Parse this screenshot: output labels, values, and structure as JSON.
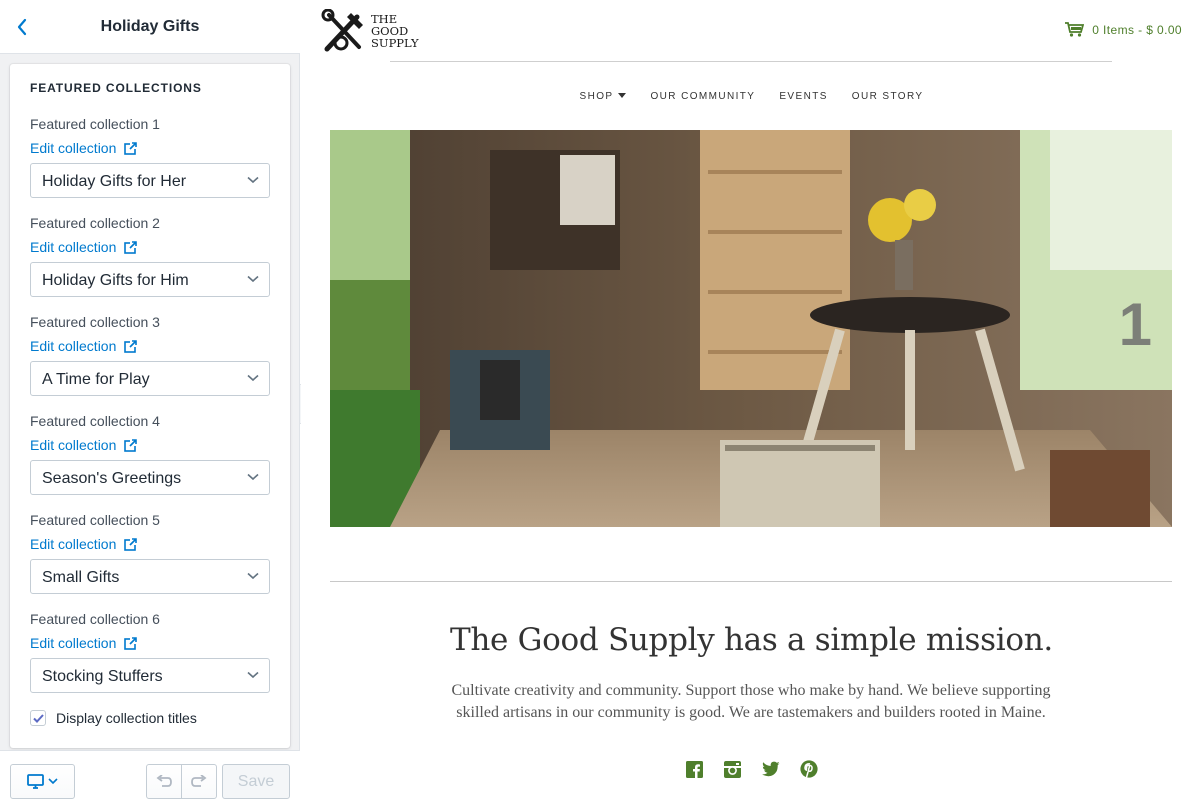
{
  "editor": {
    "title": "Holiday Gifts",
    "section_heading": "FEATURED COLLECTIONS",
    "edit_link_label": "Edit collection",
    "collections": [
      {
        "label": "Featured collection 1",
        "value": "Holiday Gifts for Her"
      },
      {
        "label": "Featured collection 2",
        "value": "Holiday Gifts for Him"
      },
      {
        "label": "Featured collection 3",
        "value": "A Time for Play"
      },
      {
        "label": "Featured collection 4",
        "value": "Season's Greetings"
      },
      {
        "label": "Featured collection 5",
        "value": "Small Gifts"
      },
      {
        "label": "Featured collection 6",
        "value": "Stocking Stuffers"
      }
    ],
    "display_titles": {
      "label": "Display collection titles",
      "checked": true
    },
    "footer": {
      "save_label": "Save"
    }
  },
  "storefront": {
    "logo_lines": [
      "THE",
      "GOOD",
      "SUPPLY"
    ],
    "cart": "0 Items - $ 0.00",
    "nav": [
      "SHOP",
      "OUR COMMUNITY",
      "EVENTS",
      "OUR STORY"
    ],
    "slide_number": "1",
    "mission_title": "The Good Supply has a simple mission.",
    "mission_body": "Cultivate creativity and community. Support those who make by hand. We believe supporting skilled artisans in our community is good. We are tastemakers and builders rooted in Maine.",
    "socials": [
      "facebook-icon",
      "instagram-icon",
      "twitter-icon",
      "pinterest-icon"
    ]
  },
  "colors": {
    "link_blue": "#007ace",
    "brand_green": "#4f7f2c"
  }
}
